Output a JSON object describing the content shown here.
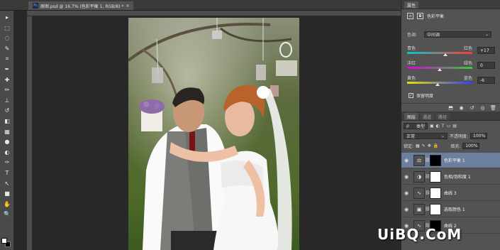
{
  "document_tab": {
    "title": "原图.psd @ 16.7% (色彩平衡 1, RGB/8) *",
    "close": "×"
  },
  "toolbar": {
    "tools": [
      "move-icon",
      "marquee-icon",
      "lasso-icon",
      "quick-select-icon",
      "crop-icon",
      "eyedropper-icon",
      "healing-icon",
      "brush-icon",
      "stamp-icon",
      "history-brush-icon",
      "eraser-icon",
      "gradient-icon",
      "blur-icon",
      "dodge-icon",
      "pen-icon",
      "type-icon",
      "path-select-icon",
      "shape-icon",
      "hand-icon",
      "zoom-icon"
    ],
    "glyphs": [
      "▸",
      "⬚",
      "◌",
      "✎",
      "⌗",
      "✒",
      "✚",
      "✏",
      "⊥",
      "↺",
      "◧",
      "▦",
      "●",
      "◐",
      "✑",
      "T",
      "↖",
      "■",
      "✋",
      "🔍"
    ],
    "fg_color": "#ffffff",
    "bg_color": "#000000"
  },
  "properties": {
    "tab_label": "属性",
    "adjustment_title": "色彩平衡",
    "tone_label": "色调:",
    "tone_value": "中间调",
    "sliders": [
      {
        "left": "青色",
        "right": "红色",
        "value": "+17",
        "position": 0.59
      },
      {
        "left": "洋红",
        "right": "绿色",
        "value": "0",
        "position": 0.5
      },
      {
        "left": "黄色",
        "right": "蓝色",
        "value": "-6",
        "position": 0.47
      }
    ],
    "preserve_luminosity": "保留明度",
    "preserve_checked": true
  },
  "layers_panel": {
    "tabs": [
      "图层",
      "通道",
      "路径"
    ],
    "filter_kind": "类型",
    "blend_mode": "正常",
    "opacity_label": "不透明度:",
    "opacity_value": "100%",
    "lock_label": "锁定:",
    "fill_label": "填充:",
    "fill_value": "100%",
    "layers": [
      {
        "name": "色彩平衡 1",
        "icon": "⚖",
        "mask": "black",
        "selected": true
      },
      {
        "name": "色相/饱和度 1",
        "icon": "◑",
        "mask": "white",
        "selected": false
      },
      {
        "name": "曲线 3",
        "icon": "∿",
        "mask": "white",
        "selected": false
      },
      {
        "name": "选取颜色 1",
        "icon": "▣",
        "mask": "white",
        "selected": false
      },
      {
        "name": "曲线 2",
        "icon": "∿",
        "mask": "black",
        "selected": false
      }
    ]
  },
  "watermark": "UiBQ.CoM",
  "colors": {
    "selected_layer": "#6d7f9e",
    "panel_bg": "#535353",
    "canvas_bg": "#282828"
  }
}
